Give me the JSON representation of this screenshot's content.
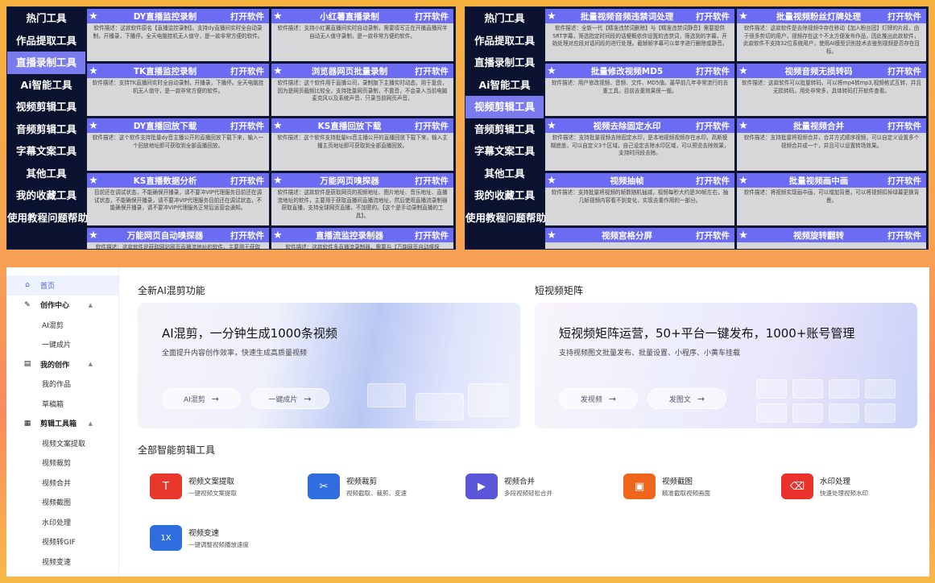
{
  "left_panel": {
    "nav": [
      "热门工具",
      "作品提取工具",
      "直播录制工具",
      "Ai智能工具",
      "视频剪辑工具",
      "音频剪辑工具",
      "字幕文案工具",
      "其他工具",
      "我的收藏工具",
      "使用教程问题帮助"
    ],
    "active_index": 2,
    "open_label": "打开软件",
    "cards": [
      {
        "title": "DY直播监控录制",
        "desc": "软件描述：这款软件原名【直播监控录制】。支持dy直播间实时全自动录制，开播录，下播停。全天电脑挂机无人值守，是一款非常方便的软件。"
      },
      {
        "title": "小红薯直播录制",
        "desc": "软件描述：支持小红薯直播间实时自动录制，需要填写正在开播直播间半自动无人值守录制，是一款非常方便的软件。"
      },
      {
        "title": "TK直播监控录制",
        "desc": "软件描述：支持TK直播间实时全自动录制，开播录，下播停。全天电脑挂机无人值守，是一款非常方便的软件。"
      },
      {
        "title": "浏览器网页批量录制",
        "desc": "软件描述：这个软件用于直播公司，录制旗下主播实时动态，用于复盘，因为是网页截频比较全，支持批量网页录制，不靠音，不会录入当前电脑麦克风以及系统声音，只录当前网页声音。"
      },
      {
        "title": "DY直播回放下载",
        "desc": "软件描述：这个软件支持批量dy音主播公开的直播回放下载下来，输入一个回放地址即可获取到全部直播回放。"
      },
      {
        "title": "KS直播回放下载",
        "desc": "软件描述：这个软件支持批量ks音主播公开的直播回放下载下来，输入主播主页地址即可获取到全部直播回放。"
      },
      {
        "title": "KS直播数据分析",
        "desc": "目前还在调试状态，不能确保开播录，请不要冲VIP代理服务目前还在调试状态，不能确保开播录，请不要冲VIP代理服务目前还在调试状态，不能确保开播录，请不要冲VIP代理服务正常后运营会通知。"
      },
      {
        "title": "万能网页嗅探器",
        "desc": "软件描述：这款软件是获取网页的视频地址、图片地址、音乐地址、直播流地址的软件，主要用于获取直播间直播流地址，然后使用直播流录制器获取直播，支持全球网页直播，不加密的。【这个是手动录制直播的工具】。"
      },
      {
        "title": "万能网页自动嗅探器",
        "desc": "软件描述：这款软件是获取网站网页直播流地址的软件，主要用于获取"
      },
      {
        "title": "直播流监控录制器",
        "desc": "软件描述：这款软件多直播流录制器，需要与【万能网页自动嗅探"
      }
    ]
  },
  "right_panel": {
    "nav": [
      "热门工具",
      "作品提取工具",
      "直播录制工具",
      "Ai智能工具",
      "视频剪辑工具",
      "音频剪辑工具",
      "字幕文案工具",
      "其他工具",
      "我的收藏工具",
      "使用教程问题帮助"
    ],
    "active_index": 4,
    "open_label": "打开软件",
    "cards": [
      {
        "title": "批量视频音频违禁词处理",
        "desc": "软件描述：全新一代【精准违禁词删除】与【精准违禁词静音】需要提供SRT字幕，筛选指定时间段的话梗概依你设置的违禁词，筛选到的字幕，开始处理对应段对话间段的进行处理。截帧帧字幕可以单字进行删除或静音。"
      },
      {
        "title": "批量视频粉丝灯牌处理",
        "desc": "软件描述：这款软件是去除视频中存在移动【加入粉丝团】灯牌的片段，由于很多剪切的用户，视频存在这个不太方便发布作品，因此推出此款软件，此款软件不支持32位系统用户，使用AI模型识别技术去鉴别视频是否存在目标。"
      },
      {
        "title": "批量修改视频MD5",
        "desc": "软件描述：用户修改视频、音频、文件、MD5值。最早前几年非常流行的去重工具，目前去重效果很一般。"
      },
      {
        "title": "视频音频无损转码",
        "desc": "软件描述：这款软件可以批量转码，可以将mp4转mp3,视频格式互转，并且无损转码，用处非常多，具体转码打开软件查看。"
      },
      {
        "title": "视频去除固定水印",
        "desc": "软件描述：支持批量视频去除固定水印，是本地视频视频存在水印，高斯模糊遮盖，可以自定义3个区域，自己设定去除水印区域，可以预览去除效果，支持时间段去除。"
      },
      {
        "title": "批量视频合并",
        "desc": "软件描述：支持批量将视频合并，合并方式顺序视频，可以自定义设置多个视频合并成一个，并且可以设置转场效果。"
      },
      {
        "title": "视频抽帧",
        "desc": "软件描述：支持批量将视频的帧数随机抽减，视频每秒大约是30帧左右，抽几帧视频内容看不到变化，实现去重作用的一部分。"
      },
      {
        "title": "批量视频画中画",
        "desc": "软件描述：将视频实现画中画，可以增加背景，可以将视频扣掉绿幕更换背景。"
      },
      {
        "title": "视频宫格分屏",
        "desc": ""
      },
      {
        "title": "视频旋转翻转",
        "desc": ""
      }
    ]
  },
  "app": {
    "sidebar": {
      "home": "首页",
      "groups": [
        {
          "label": "创作中心",
          "items": [
            "AI混剪",
            "一键成片"
          ]
        },
        {
          "label": "我的创作",
          "items": [
            "我的作品",
            "草稿箱"
          ]
        },
        {
          "label": "剪辑工具箱",
          "items": [
            "视频文案提取",
            "视频裁剪",
            "视频合并",
            "视频截图",
            "水印处理",
            "视频转GIF",
            "视频变速"
          ]
        }
      ]
    },
    "section_ai": "全新AI混剪功能",
    "section_matrix": "短视频矩阵",
    "banner_ai": {
      "headline": "AI混剪，一分钟生成1000条视频",
      "sub": "全面提升内容创作效率，快速生成高质量视频",
      "btn1": "AI混剪",
      "btn2": "一键成片"
    },
    "banner_matrix": {
      "headline": "短视频矩阵运营，50+平台一键发布，1000+账号管理",
      "sub": "支持视频图文批量发布、批量设置、小程序、小黄车挂载",
      "btn1": "发视频",
      "btn2": "发图文"
    },
    "section_tools": "全部智能剪辑工具",
    "tools": [
      {
        "name": "视频文案提取",
        "desc": "一键视频文案提取",
        "color": "#e8372d",
        "glyph": "T"
      },
      {
        "name": "视频裁剪",
        "desc": "视频截取、裁剪、变速",
        "color": "#2f6de1",
        "glyph": "✂"
      },
      {
        "name": "视频合并",
        "desc": "多段视频轻松合并",
        "color": "#5b56d9",
        "glyph": "▶"
      },
      {
        "name": "视频截图",
        "desc": "精准截取视频画面",
        "color": "#f0651c",
        "glyph": "▣"
      },
      {
        "name": "水印处理",
        "desc": "快速处理视频水印",
        "color": "#e8322b",
        "glyph": "⌫"
      },
      {
        "name": "视频变速",
        "desc": "一键调整视频播放速度",
        "color": "#2f6de1",
        "glyph": "1X"
      }
    ]
  }
}
